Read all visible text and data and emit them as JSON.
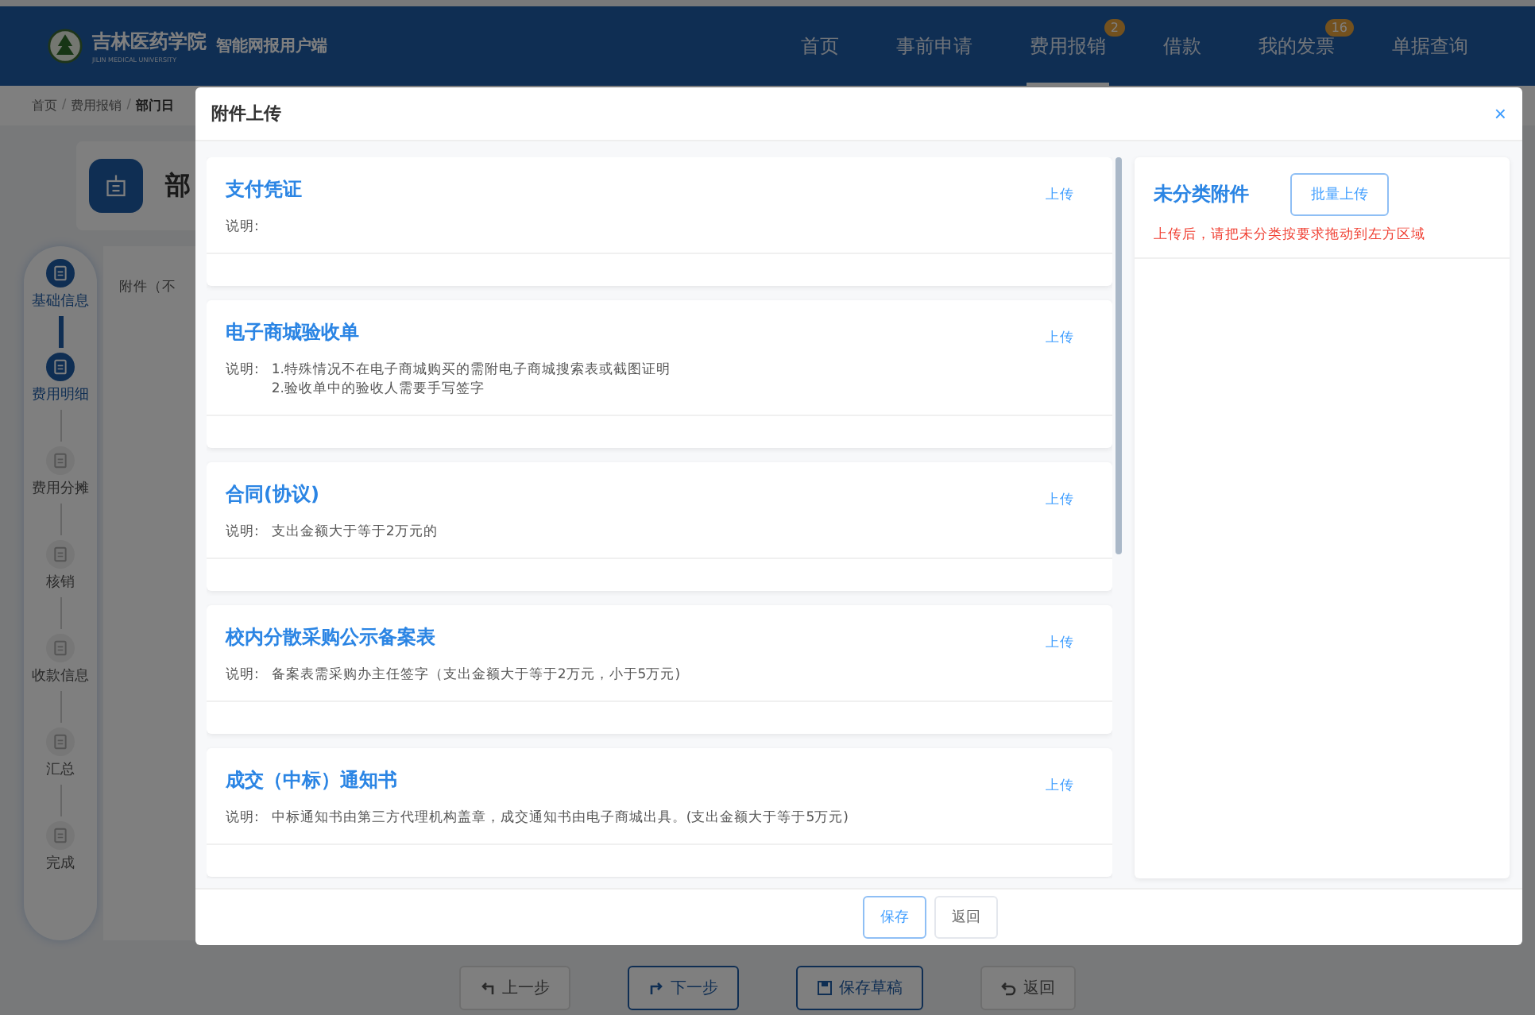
{
  "header": {
    "school_name": "吉林医药学院",
    "school_subtitle": "JILIN MEDICAL UNIVERSITY",
    "app_name": "智能网报用户端",
    "nav": [
      {
        "label": "首页",
        "selected": false
      },
      {
        "label": "事前申请",
        "selected": false
      },
      {
        "label": "费用报销",
        "selected": true,
        "badge": "2"
      },
      {
        "label": "借款",
        "selected": false
      },
      {
        "label": "我的发票",
        "selected": false,
        "badge": "16"
      },
      {
        "label": "单据查询",
        "selected": false
      }
    ]
  },
  "breadcrumb": [
    "首页",
    "费用报销",
    "部门日"
  ],
  "breadcrumb_separator": "/",
  "page_title": "部",
  "steps": [
    {
      "label": "基础信息",
      "active": true
    },
    {
      "label": "费用明细",
      "active": true
    },
    {
      "label": "费用分摊",
      "active": false
    },
    {
      "label": "核销",
      "active": false
    },
    {
      "label": "收款信息",
      "active": false
    },
    {
      "label": "汇总",
      "active": false
    },
    {
      "label": "完成",
      "active": false
    }
  ],
  "form": {
    "field_label": "附件（不"
  },
  "bottom_buttons": [
    {
      "label": "上一步",
      "kind": "prev"
    },
    {
      "label": "下一步",
      "kind": "next"
    },
    {
      "label": "保存草稿",
      "kind": "draft"
    },
    {
      "label": "返回",
      "kind": "back"
    }
  ],
  "dialog": {
    "title": "附件上传",
    "close": "×",
    "categories": [
      {
        "title": "支付凭证",
        "note_label": "说明:",
        "action": "上传"
      },
      {
        "title": "电子商城验收单",
        "note_label": "说明:",
        "note_lines": [
          "1.特殊情况不在电子商城购买的需附电子商城搜索表或截图证明",
          "2.验收单中的验收人需要手写签字"
        ],
        "action": "上传"
      },
      {
        "title": "合同(协议)",
        "note_label": "说明:",
        "note_lines": [
          "支出金额大于等于2万元的"
        ],
        "action": "上传"
      },
      {
        "title": "校内分散采购公示备案表",
        "note_label": "说明:",
        "note_lines": [
          "备案表需采购办主任签字（支出金额大于等于2万元，小于5万元)"
        ],
        "action": "上传"
      },
      {
        "title": "成交（中标）通知书",
        "note_label": "说明:",
        "note_lines": [
          "中标通知书由第三方代理机构盖章，成交通知书由电子商城出具。(支出金额大于等于5万元)"
        ],
        "action": "上传"
      }
    ],
    "unsorted": {
      "title": "未分类附件",
      "button": "批量上传",
      "hint": "上传后，请把未分类按要求拖动到左方区域"
    },
    "buttons": [
      {
        "label": "保存",
        "primary": true
      },
      {
        "label": "返回",
        "primary": false
      }
    ]
  }
}
